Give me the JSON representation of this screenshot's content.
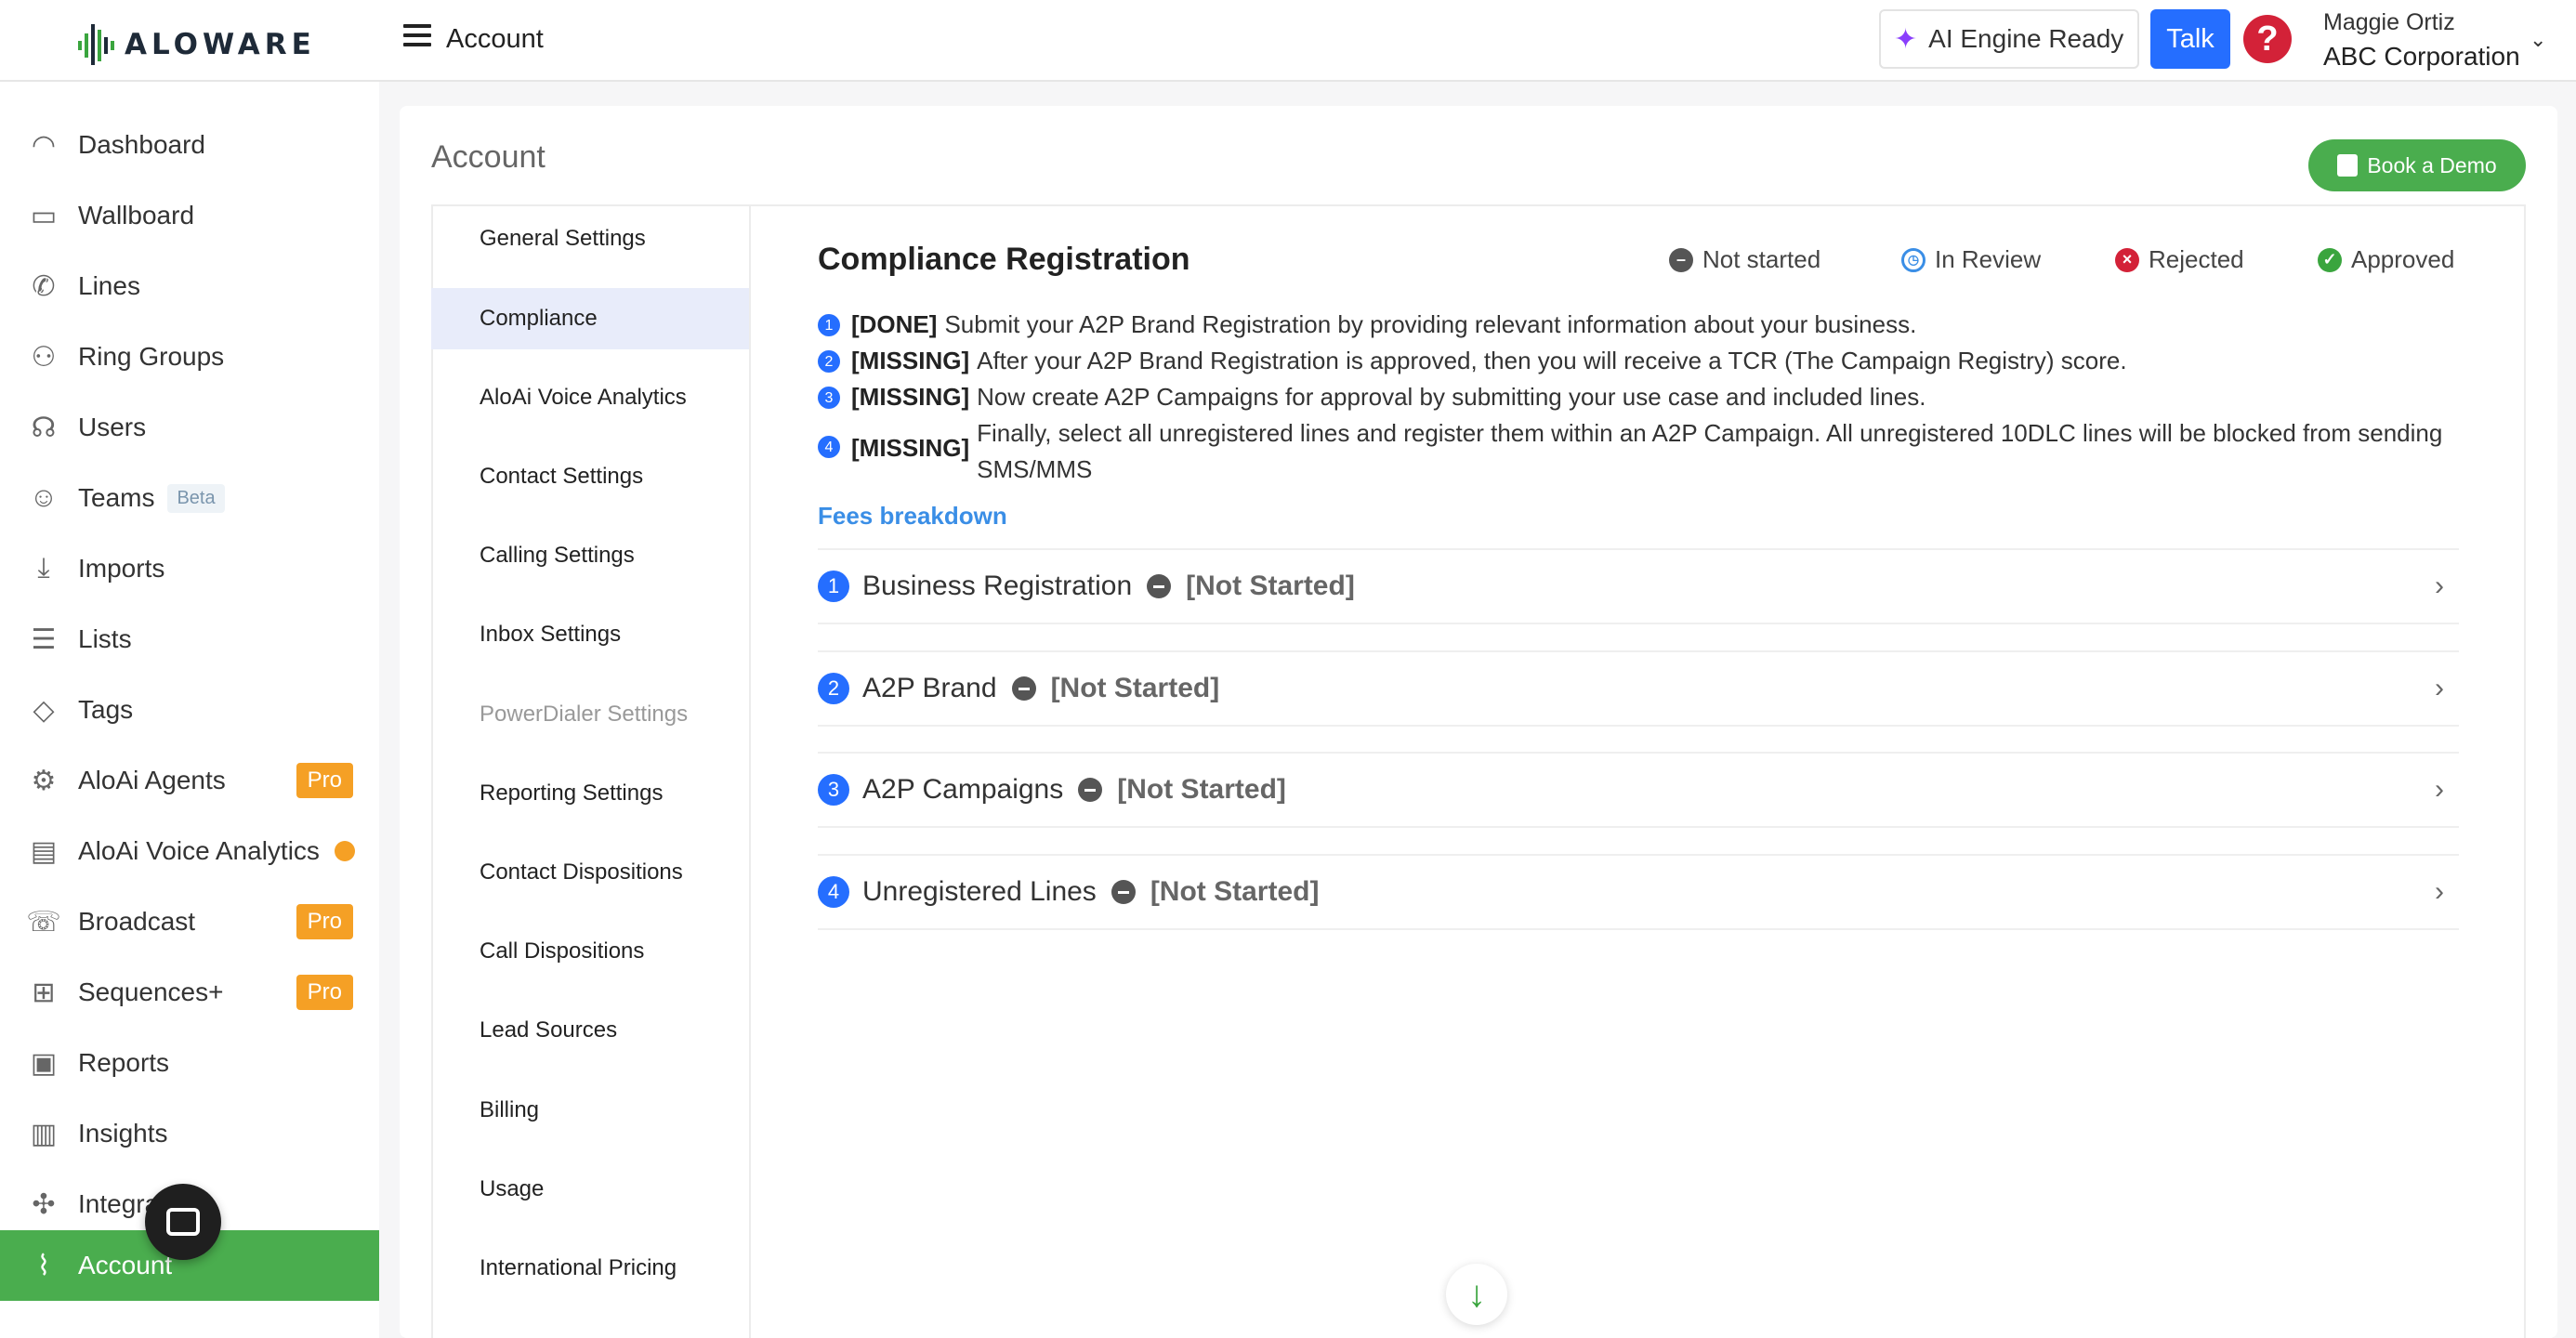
{
  "brand": {
    "name": "ALOWARE",
    "accent": "#4aad4e",
    "primary": "#256eff"
  },
  "header": {
    "title": "Account",
    "ai_status": "AI Engine Ready",
    "talk_label": "Talk",
    "user_name": "Maggie Ortiz",
    "user_company": "ABC Corporation"
  },
  "sidebar": {
    "items": [
      {
        "label": "Dashboard",
        "icon": "dashboard-icon"
      },
      {
        "label": "Wallboard",
        "icon": "wallboard-icon"
      },
      {
        "label": "Lines",
        "icon": "phone-icon"
      },
      {
        "label": "Ring Groups",
        "icon": "ring-groups-icon"
      },
      {
        "label": "Users",
        "icon": "users-icon"
      },
      {
        "label": "Teams",
        "icon": "teams-icon",
        "badge": "Beta"
      },
      {
        "label": "Imports",
        "icon": "import-icon"
      },
      {
        "label": "Lists",
        "icon": "list-icon"
      },
      {
        "label": "Tags",
        "icon": "tag-icon"
      },
      {
        "label": "AloAi Agents",
        "icon": "agents-icon",
        "badge": "Pro"
      },
      {
        "label": "AloAi Voice Analytics",
        "icon": "analytics-icon"
      },
      {
        "label": "Broadcast",
        "icon": "broadcast-icon",
        "badge": "Pro"
      },
      {
        "label": "Sequences+",
        "icon": "sequences-icon",
        "badge": "Pro"
      },
      {
        "label": "Reports",
        "icon": "reports-icon"
      },
      {
        "label": "Insights",
        "icon": "insights-icon"
      },
      {
        "label": "Integrations",
        "icon": "integrations-icon"
      },
      {
        "label": "Account",
        "icon": "account-icon"
      }
    ]
  },
  "page": {
    "title": "Account",
    "book_demo_label": "Book a Demo"
  },
  "subnav": {
    "items": [
      "General Settings",
      "Compliance",
      "AloAi Voice Analytics",
      "Contact Settings",
      "Calling Settings",
      "Inbox Settings",
      "PowerDialer Settings",
      "Reporting Settings",
      "Contact Dispositions",
      "Call Dispositions",
      "Lead Sources",
      "Billing",
      "Usage",
      "International Pricing"
    ]
  },
  "compliance": {
    "title": "Compliance Registration",
    "legend": {
      "not_started": "Not started",
      "in_review": "In Review",
      "rejected": "Rejected",
      "approved": "Approved"
    },
    "steps": [
      {
        "num": "1",
        "tag": "[DONE]",
        "text": "Submit your A2P Brand Registration by providing relevant information about your business."
      },
      {
        "num": "2",
        "tag": "[MISSING]",
        "text": "After your A2P Brand Registration is approved, then you will receive a TCR (The Campaign Registry) score."
      },
      {
        "num": "3",
        "tag": "[MISSING]",
        "text": "Now create A2P Campaigns for approval by submitting your use case and included lines."
      },
      {
        "num": "4",
        "tag": "[MISSING]",
        "text": "Finally, select all unregistered lines and register them within an A2P Campaign. All unregistered 10DLC lines will be blocked from sending SMS/MMS"
      }
    ],
    "fees_link": "Fees breakdown",
    "sections": [
      {
        "num": "1",
        "name": "Business Registration",
        "status": "[Not Started]"
      },
      {
        "num": "2",
        "name": "A2P Brand",
        "status": "[Not Started]"
      },
      {
        "num": "3",
        "name": "A2P Campaigns",
        "status": "[Not Started]"
      },
      {
        "num": "4",
        "name": "Unregistered Lines",
        "status": "[Not Started]"
      }
    ]
  }
}
